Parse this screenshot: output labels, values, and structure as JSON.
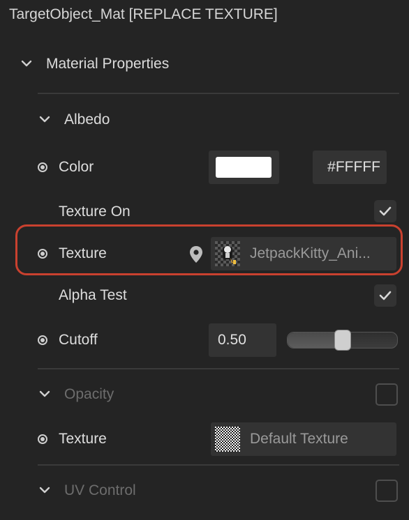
{
  "header": {
    "title": "TargetObject_Mat [REPLACE TEXTURE]"
  },
  "material": {
    "section_label": "Material Properties",
    "albedo": {
      "label": "Albedo",
      "color": {
        "label": "Color",
        "swatch": "#FFFFFF",
        "hex": "#FFFFF"
      },
      "texture_on": {
        "label": "Texture On",
        "checked": true
      },
      "texture": {
        "label": "Texture",
        "value": "JetpackKitty_Ani..."
      },
      "alpha_test": {
        "label": "Alpha Test",
        "checked": true
      },
      "cutoff": {
        "label": "Cutoff",
        "value": "0.50",
        "level": 0.5
      }
    },
    "opacity": {
      "label": "Opacity",
      "enabled": false,
      "texture": {
        "label": "Texture",
        "value": "Default Texture"
      }
    },
    "uv_control": {
      "label": "UV Control",
      "enabled": false
    }
  },
  "colors": {
    "accent_highlight": "#C9412F",
    "background": "#242424"
  }
}
